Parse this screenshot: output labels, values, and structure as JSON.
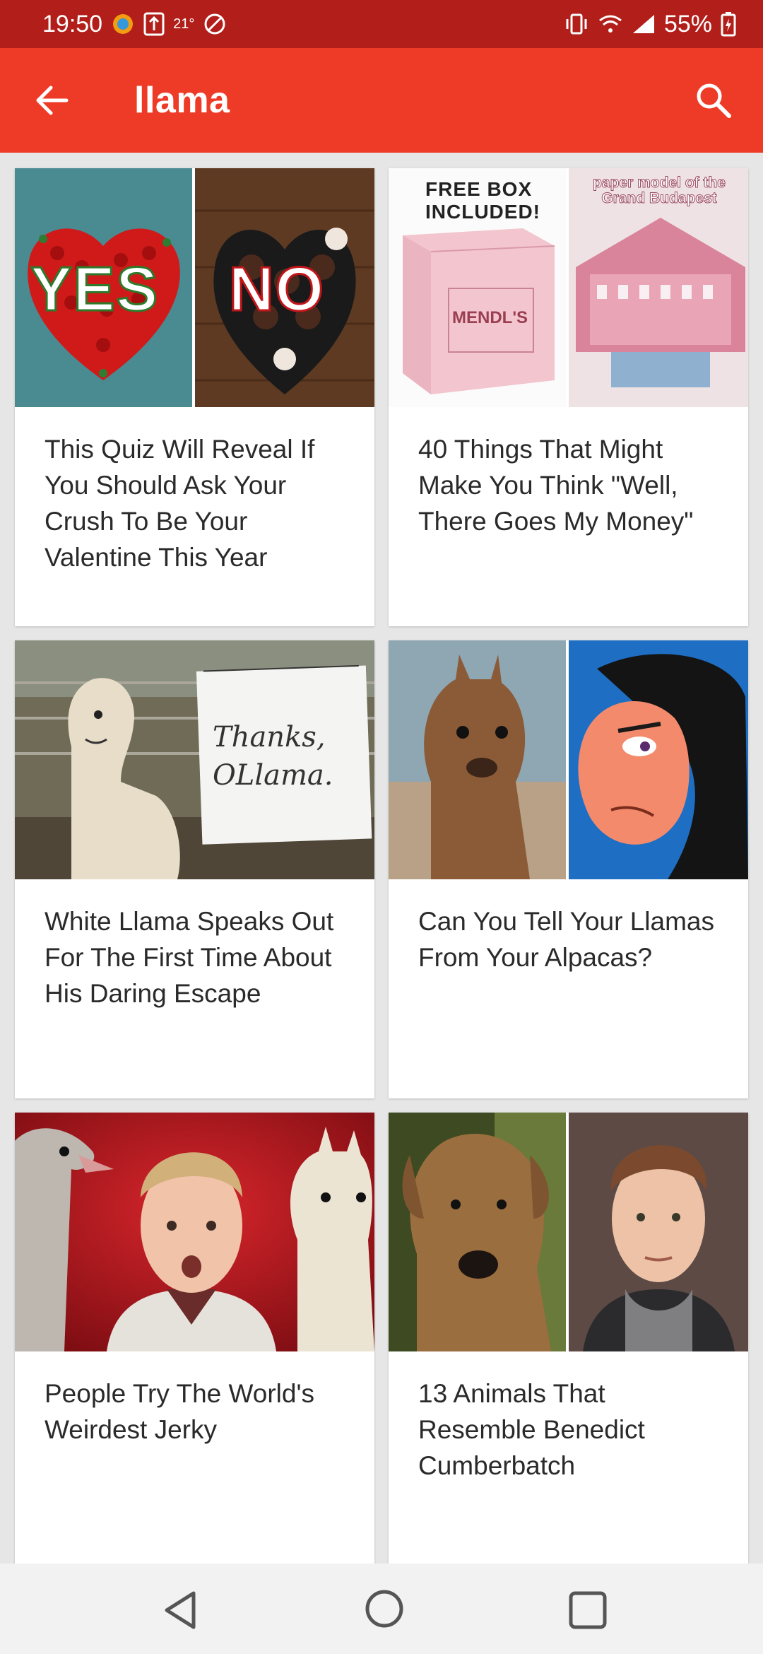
{
  "status_bar": {
    "time": "19:50",
    "temperature": "21°",
    "battery": "55%"
  },
  "app_bar": {
    "title": "llama"
  },
  "cards": [
    {
      "headline": "This Quiz Will Reveal If You Should Ask Your Crush To Be Your Valentine This Year",
      "thumb_text_left": "YES",
      "thumb_text_right": "NO"
    },
    {
      "headline": "40 Things That Might Make You Think \"Well, There Goes My Money\"",
      "thumb_text_left": "FREE BOX INCLUDED!",
      "thumb_text_right": "paper model of the Grand Budapest",
      "box_brand": "MENDL'S"
    },
    {
      "headline": "White Llama Speaks Out For The First Time About His Daring Escape",
      "thumb_sign": "Thanks, OLlama."
    },
    {
      "headline": "Can You Tell Your Llamas From Your Alpacas?"
    },
    {
      "headline": "People Try The World's Weirdest Jerky"
    },
    {
      "headline": "13 Animals That Resemble Benedict Cumberbatch"
    }
  ],
  "colors": {
    "status_bar": "#b21f1a",
    "app_bar": "#ee3b27",
    "background": "#e6e6e6"
  }
}
